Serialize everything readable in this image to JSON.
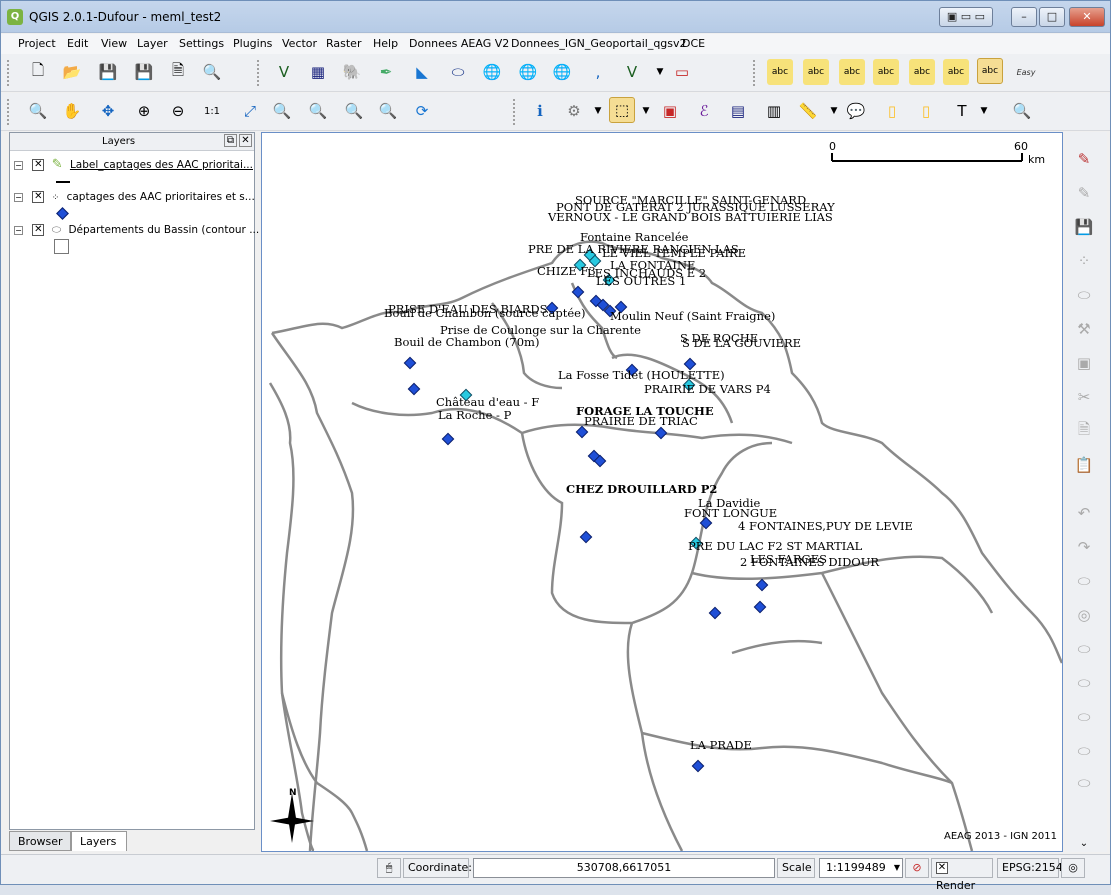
{
  "window": {
    "title": "QGIS 2.0.1-Dufour - meml_test2"
  },
  "menu": [
    "Project",
    "Edit",
    "View",
    "Layer",
    "Settings",
    "Plugins",
    "Vector",
    "Raster",
    "Help",
    "Donnees AEAG V2",
    "Donnees_IGN_Geoportail_qgsv2",
    "DCE"
  ],
  "layers_panel": {
    "title": "Layers",
    "items": [
      {
        "label": "Label_captages des AAC prioritai..."
      },
      {
        "label": "captages des AAC prioritaires et s..."
      },
      {
        "label": "Départements du Bassin (contour ..."
      }
    ]
  },
  "tabs": {
    "browser": "Browser",
    "layers": "Layers"
  },
  "map": {
    "scalebar": {
      "start": "0",
      "end": "60",
      "unit": "km"
    },
    "north": "N",
    "copyright": "AEAG 2013 - IGN 2011",
    "labels": [
      {
        "text": "SOURCE \"MARCILLE\" SAINT-GENARD"
      },
      {
        "text": "PONT DE GATERAT 2 JURASSIQUE LUSSERAY"
      },
      {
        "text": "VERNOUX - LE GRAND BOIS BATTUIERIE LIAS"
      },
      {
        "text": "Fontaine Rancelée"
      },
      {
        "text": "PRE DE LA RIVIERE RANCIEN LAS"
      },
      {
        "text": "LE VIEL TEMPLE PAIRE"
      },
      {
        "text": "LA FONTAINE"
      },
      {
        "text": "CHIZE F3"
      },
      {
        "text": "LES INCHAUDS E 2"
      },
      {
        "text": "LES OUTRES 1"
      },
      {
        "text": "PRISE D'EAU DES BIARDS"
      },
      {
        "text": "Bouil de Chambon (source captée)"
      },
      {
        "text": "Moulin Neuf (Saint Fraigne)"
      },
      {
        "text": "Prise de Coulonge sur la Charente"
      },
      {
        "text": "Bouil de Chambon (70m)"
      },
      {
        "text": "S DE ROCHE"
      },
      {
        "text": "S DE LA GOUVIERE"
      },
      {
        "text": "La Fosse Tidet (HOULETTE)"
      },
      {
        "text": "PRAIRIE DE VARS P4"
      },
      {
        "text": "Château d'eau - F"
      },
      {
        "text": "La Roche - P"
      },
      {
        "text": "FORAGE LA TOUCHE"
      },
      {
        "text": "PRAIRIE DE TRIAC"
      },
      {
        "text": "CHEZ DROUILLARD P2"
      },
      {
        "text": "La Davidie"
      },
      {
        "text": "FONT LONGUE"
      },
      {
        "text": "4 FONTAINES,PUY DE LEVIE"
      },
      {
        "text": "PRE DU LAC F2 ST MARTIAL"
      },
      {
        "text": "LES FARGES"
      },
      {
        "text": "2 FONTAINES DIDOUR"
      },
      {
        "text": "LA PRADE"
      }
    ]
  },
  "status": {
    "coordinate_label": "Coordinate:",
    "coordinate_value": "530708,6617051",
    "scale_label": "Scale",
    "scale_value": "1:1199489",
    "render_label": "Render",
    "epsg": "EPSG:2154"
  }
}
